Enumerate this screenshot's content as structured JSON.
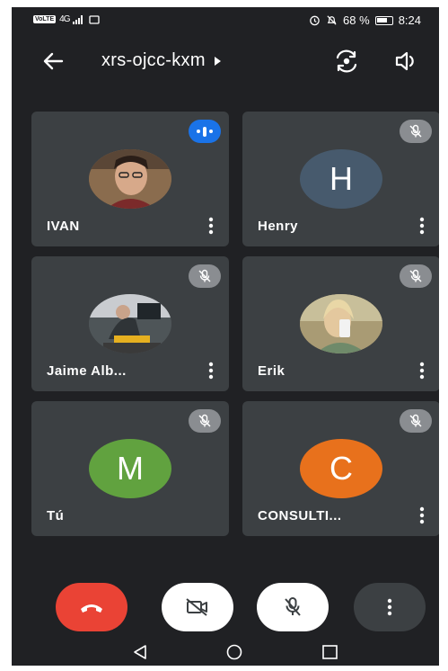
{
  "status_bar": {
    "volte": "VoLTE",
    "network": "4G",
    "battery_pct": "68 %",
    "time": "8:24"
  },
  "header": {
    "room_code": "xrs-ojcc-kxm"
  },
  "participants": [
    {
      "name": "IVAN",
      "avatar_type": "photo",
      "audio": "speaking"
    },
    {
      "name": "Henry",
      "avatar_type": "letter",
      "initial": "H",
      "color": "#475a6d",
      "audio": "muted"
    },
    {
      "name": "Jaime Alb...",
      "avatar_type": "photo",
      "audio": "muted"
    },
    {
      "name": "Erik",
      "avatar_type": "photo",
      "audio": "muted"
    },
    {
      "name": "Tú",
      "avatar_type": "letter",
      "initial": "M",
      "color": "#61a23f",
      "audio": "muted"
    },
    {
      "name": "CONSULTI...",
      "avatar_type": "letter",
      "initial": "C",
      "color": "#e8711c",
      "audio": "muted"
    }
  ],
  "controls": {
    "end_call_color": "#ea4335",
    "camera": "off",
    "mic": "muted"
  },
  "icons": [
    "back-arrow-icon",
    "flip-camera-icon",
    "speaker-icon",
    "mic-off-icon",
    "more-vert-icon",
    "end-call-icon",
    "camera-off-icon"
  ]
}
